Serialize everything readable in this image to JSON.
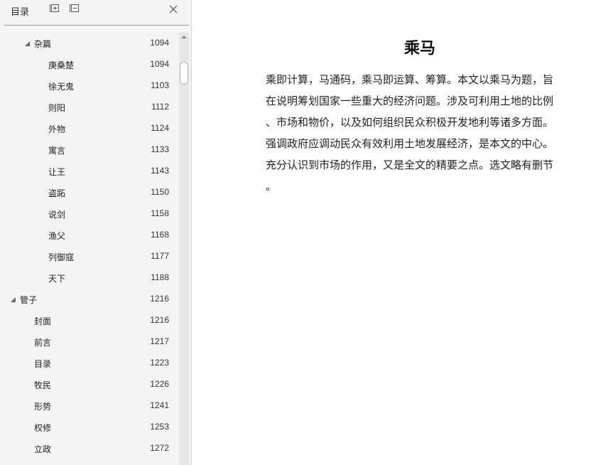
{
  "toc": {
    "title": "目录",
    "expand_icon": "expand-all-icon",
    "collapse_icon": "collapse-all-icon",
    "close_icon": "close-icon",
    "items": [
      {
        "label": "杂篇",
        "page": "1094",
        "level": 1,
        "expanded": true
      },
      {
        "label": "庚桑楚",
        "page": "1094",
        "level": 2
      },
      {
        "label": "徐无鬼",
        "page": "1103",
        "level": 2
      },
      {
        "label": "则阳",
        "page": "1112",
        "level": 2
      },
      {
        "label": "外物",
        "page": "1124",
        "level": 2
      },
      {
        "label": "寓言",
        "page": "1133",
        "level": 2
      },
      {
        "label": "让王",
        "page": "1143",
        "level": 2
      },
      {
        "label": "盗跖",
        "page": "1150",
        "level": 2
      },
      {
        "label": "说剑",
        "page": "1158",
        "level": 2
      },
      {
        "label": "渔父",
        "page": "1168",
        "level": 2
      },
      {
        "label": "列御寇",
        "page": "1177",
        "level": 2
      },
      {
        "label": "天下",
        "page": "1188",
        "level": 2
      },
      {
        "label": "管子",
        "page": "1216",
        "level": 0,
        "expanded": true
      },
      {
        "label": "封面",
        "page": "1216",
        "level": 1
      },
      {
        "label": "前言",
        "page": "1217",
        "level": 1
      },
      {
        "label": "目录",
        "page": "1223",
        "level": 1
      },
      {
        "label": "牧民",
        "page": "1226",
        "level": 1
      },
      {
        "label": "形势",
        "page": "1241",
        "level": 1
      },
      {
        "label": "权修",
        "page": "1253",
        "level": 1
      },
      {
        "label": "立政",
        "page": "1272",
        "level": 1
      },
      {
        "label": "",
        "page": "",
        "level": 1,
        "selected": true
      }
    ],
    "selection_color": "#c9a4a6"
  },
  "document": {
    "title": "乘马",
    "lines": [
      "乘即计算，马通码，乘马即运算、筹算。本文以乘马为题，旨",
      "在说明筹划国家一些重大的经济问题。涉及可利用土地的比例",
      "、市场和物价，以及如何组织民众积极开发地利等诸多方面。",
      "强调政府应调动民众有效利用土地发展经济，是本文的中心。",
      "充分认识到市场的作用，又是全文的精要之点。选文略有删节",
      "。"
    ]
  }
}
